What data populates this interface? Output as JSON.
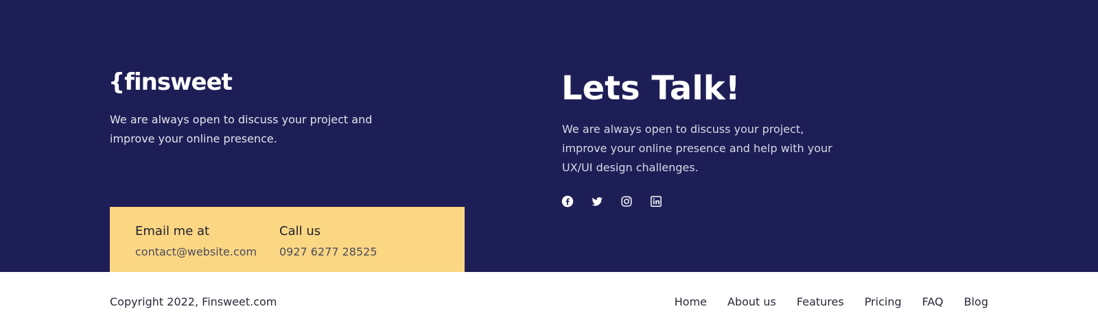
{
  "brand": {
    "logo": "{finsweet",
    "tagline": "We are always open to discuss your project and improve your online presence."
  },
  "contact": {
    "email_label": "Email me at",
    "email_value": "contact@website.com",
    "phone_label": "Call us",
    "phone_value": "0927 6277 28525"
  },
  "talk": {
    "title": "Lets Talk!",
    "description": "We are always open to discuss your project, improve your online presence and help with your UX/UI design challenges."
  },
  "social": {
    "icons": [
      "facebook-icon",
      "twitter-icon",
      "instagram-icon",
      "linkedin-icon"
    ]
  },
  "footer": {
    "copyright": "Copyright 2022, Finsweet.com",
    "nav": [
      "Home",
      "About us",
      "Features",
      "Pricing",
      "FAQ",
      "Blog"
    ]
  },
  "colors": {
    "primary_bg": "#1E1E57",
    "accent": "#FBD784",
    "text_dark": "#282938"
  }
}
